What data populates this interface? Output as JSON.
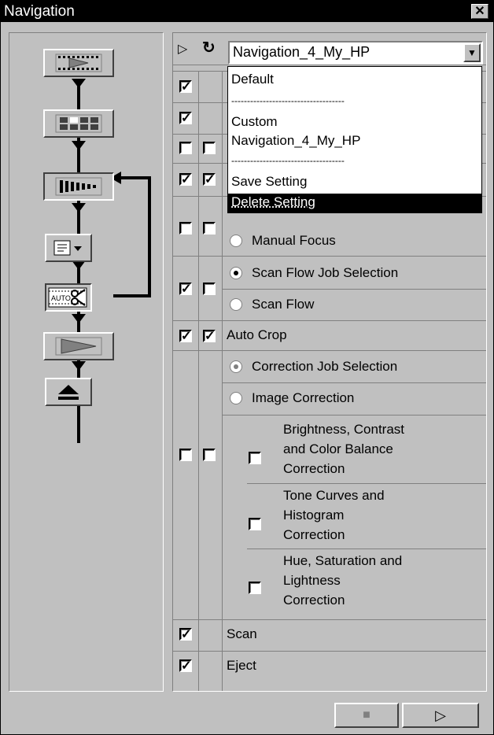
{
  "window": {
    "title": "Navigation",
    "close_glyph": "✕"
  },
  "left_panel": {
    "flow_buttons": [
      {
        "name": "prescan-button",
        "icon": "prescan-icon"
      },
      {
        "name": "index-scan-button",
        "icon": "index-scan-icon"
      },
      {
        "name": "film-strip-button",
        "icon": "film-strip-icon"
      },
      {
        "name": "job-select-button",
        "icon": "job-select-icon"
      },
      {
        "name": "auto-crop-button",
        "icon": "auto-crop-icon",
        "label": "AUTO"
      },
      {
        "name": "scan-button",
        "icon": "scan-play-icon"
      },
      {
        "name": "eject-button",
        "icon": "eject-icon"
      }
    ]
  },
  "header": {
    "play_glyph": "▷",
    "refresh_glyph": "↻",
    "combo_value": "Navigation_4_My_HP"
  },
  "dropdown": {
    "items": [
      {
        "label": "Default",
        "selected": false
      },
      {
        "label": "------------------------------------",
        "separator": true
      },
      {
        "label": "Custom",
        "selected": false
      },
      {
        "label": "Navigation_4_My_HP",
        "selected": false
      },
      {
        "label": "------------------------------------",
        "separator": true
      },
      {
        "label": "Save Setting",
        "selected": false
      },
      {
        "label": "Delete Setting",
        "selected": true
      }
    ]
  },
  "rows": {
    "manual_focus": "Manual Focus",
    "scan_flow_job_selection": "Scan Flow Job Selection",
    "scan_flow": "Scan Flow",
    "auto_crop": "Auto Crop",
    "correction_job_selection": "Correction Job Selection",
    "image_correction": "Image Correction",
    "brightness_1": "Brightness, Contrast",
    "brightness_2": "and Color Balance",
    "brightness_3": "Correction",
    "tone_1": "Tone Curves and",
    "tone_2": "Histogram",
    "tone_3": "Correction",
    "hue_1": "Hue, Saturation and",
    "hue_2": "Lightness",
    "hue_3": "Correction",
    "scan": "Scan",
    "eject": "Eject"
  },
  "checks": {
    "r1_a": true,
    "r2_a": true,
    "r3_a": false,
    "r3_b": false,
    "r4_a": true,
    "r4_b": true,
    "r5_a": false,
    "r5_b": false,
    "r6_a": true,
    "r6_b": false,
    "r7_a": true,
    "r7_b": true,
    "r8_a": false,
    "r8_b": false,
    "scan_a": true,
    "eject_a": true
  },
  "bottom": {
    "stop_glyph": "■",
    "play_glyph": "▷"
  },
  "colors": {
    "face": "#c0c0c0",
    "selection": "#000000",
    "flow_line": "#000000"
  }
}
